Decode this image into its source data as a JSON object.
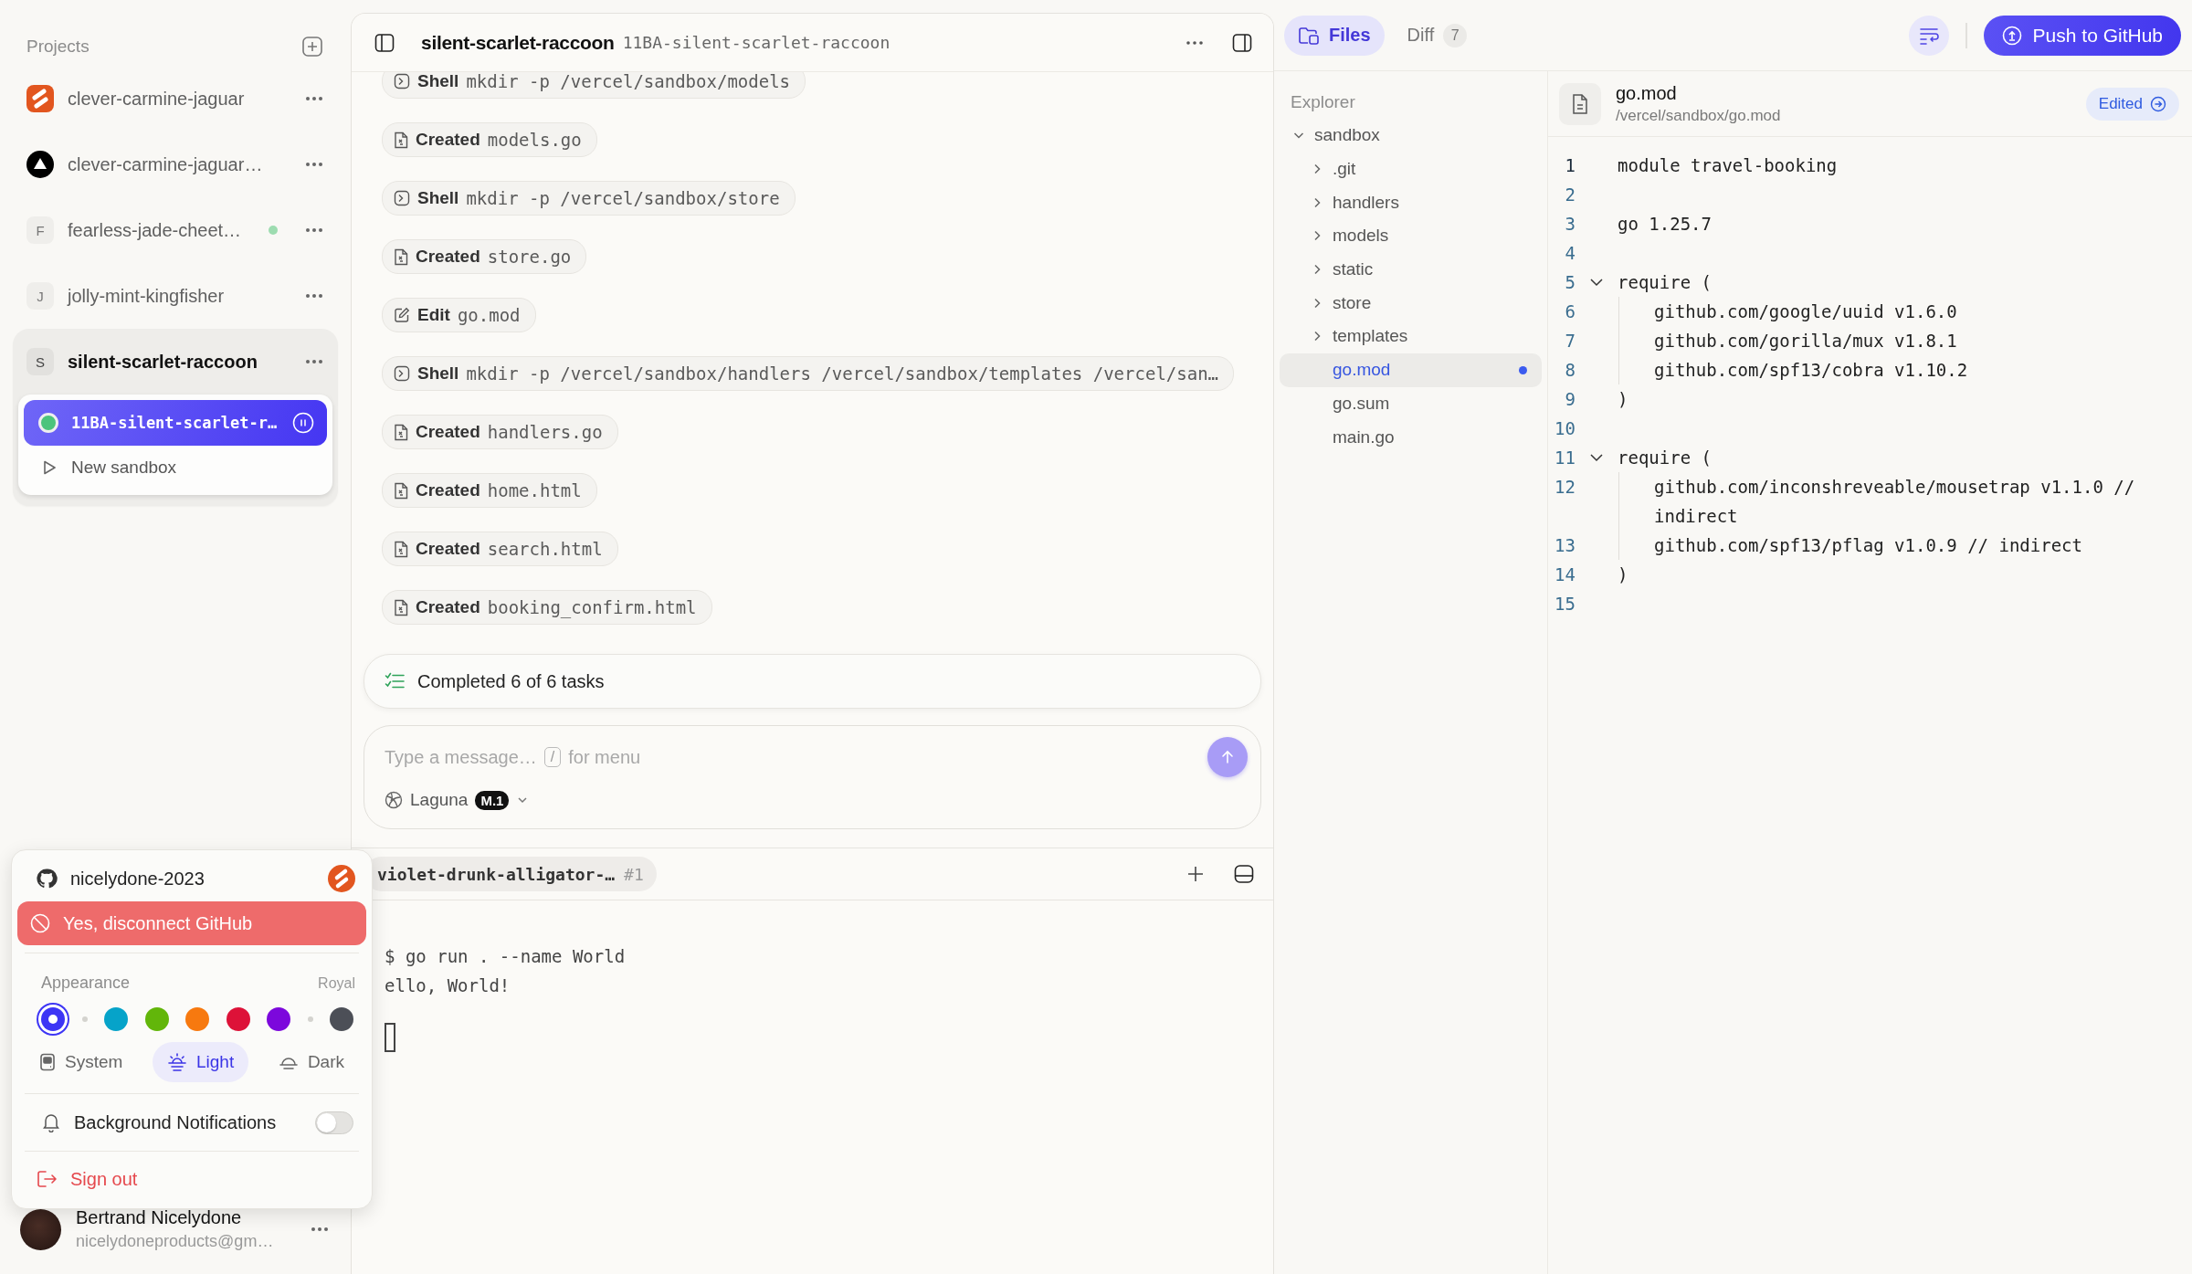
{
  "sidebar": {
    "title": "Projects",
    "projects": [
      {
        "name": "clever-carmine-jaguar",
        "kind": "orange-logo",
        "online": false,
        "selected": false
      },
      {
        "name": "clever-carmine-jaguar…",
        "kind": "triangle-logo",
        "online": false,
        "selected": false
      },
      {
        "name": "fearless-jade-cheet…",
        "kind": "letter",
        "letter": "F",
        "online": true,
        "selected": false
      },
      {
        "name": "jolly-mint-kingfisher",
        "kind": "letter",
        "letter": "J",
        "online": false,
        "selected": false
      },
      {
        "name": "silent-scarlet-raccoon",
        "kind": "letter",
        "letter": "S",
        "online": false,
        "selected": true,
        "sandboxes": [
          {
            "name": "11BA-silent-scarlet-r…",
            "running": true,
            "selected": true
          }
        ],
        "new_sandbox": "New sandbox"
      }
    ]
  },
  "account_menu": {
    "username": "nicelydone-2023",
    "disconnect": "Yes, disconnect GitHub",
    "appearance": "Appearance",
    "theme": "Royal",
    "swatches": [
      {
        "kind": "swatch",
        "color": "#3d35f5",
        "selected": true
      },
      {
        "kind": "separator"
      },
      {
        "kind": "swatch",
        "color": "#06a3c9",
        "selected": false
      },
      {
        "kind": "swatch",
        "color": "#62b60a",
        "selected": false
      },
      {
        "kind": "swatch",
        "color": "#f7790f",
        "selected": false
      },
      {
        "kind": "swatch",
        "color": "#dd1238",
        "selected": false
      },
      {
        "kind": "swatch",
        "color": "#7c08dc",
        "selected": false
      },
      {
        "kind": "separator"
      },
      {
        "kind": "swatch",
        "color": "#4c4f57",
        "selected": false
      }
    ],
    "modes": [
      {
        "label": "System",
        "kind": "system",
        "selected": false
      },
      {
        "label": "Light",
        "kind": "light",
        "selected": true
      },
      {
        "label": "Dark",
        "kind": "dark",
        "selected": false
      }
    ],
    "notifications": {
      "label": "Background Notifications",
      "on": false
    },
    "sign_out": "Sign out"
  },
  "user": {
    "name": "Bertrand Nicelydone",
    "email": "nicelydoneproducts@gm…"
  },
  "chat": {
    "title": "silent-scarlet-raccoon",
    "subtitle": "11BA-silent-scarlet-raccoon",
    "actions": [
      {
        "kind": "shell",
        "verb": "Shell",
        "arg": "mkdir -p /vercel/sandbox/models"
      },
      {
        "kind": "created",
        "verb": "Created",
        "arg": "models.go"
      },
      {
        "kind": "shell",
        "verb": "Shell",
        "arg": "mkdir -p /vercel/sandbox/store"
      },
      {
        "kind": "created",
        "verb": "Created",
        "arg": "store.go"
      },
      {
        "kind": "edit",
        "verb": "Edit",
        "arg": "go.mod"
      },
      {
        "kind": "shell",
        "verb": "Shell",
        "arg": "mkdir -p /vercel/sandbox/handlers /vercel/sandbox/templates /vercel/san…"
      },
      {
        "kind": "created",
        "verb": "Created",
        "arg": "handlers.go"
      },
      {
        "kind": "created",
        "verb": "Created",
        "arg": "home.html"
      },
      {
        "kind": "created",
        "verb": "Created",
        "arg": "search.html"
      },
      {
        "kind": "created",
        "verb": "Created",
        "arg": "booking_confirm.html"
      }
    ],
    "summary": "Completed 6 of 6 tasks",
    "composer": {
      "placeholder": "Type a message…",
      "shortcut_key": "/",
      "shortcut_hint": "for menu",
      "model": "Laguna",
      "model_badge": "M.1"
    }
  },
  "terminal": {
    "tab": "violet-drunk-alligator-…",
    "tab_number": "#1",
    "lines": [
      "$ go run . --name World",
      "ello, World!"
    ]
  },
  "top_tabs": [
    {
      "label": "Files",
      "kind": "files",
      "selected": true
    },
    {
      "label": "Diff",
      "kind": "diff",
      "count": "7",
      "selected": false
    }
  ],
  "push_button": "Push to GitHub",
  "explorer": {
    "title": "Explorer",
    "tree": [
      {
        "name": "sandbox",
        "kind": "folder",
        "expanded": true,
        "selected": false,
        "children": [
          {
            "name": ".git",
            "kind": "folder",
            "expanded": false,
            "selected": false
          },
          {
            "name": "handlers",
            "kind": "folder",
            "expanded": false,
            "selected": false
          },
          {
            "name": "models",
            "kind": "folder",
            "expanded": false,
            "selected": false
          },
          {
            "name": "static",
            "kind": "folder",
            "expanded": false,
            "selected": false
          },
          {
            "name": "store",
            "kind": "folder",
            "expanded": false,
            "selected": false
          },
          {
            "name": "templates",
            "kind": "folder",
            "expanded": false,
            "selected": false
          },
          {
            "name": "go.mod",
            "kind": "file",
            "modified": true,
            "selected": true
          },
          {
            "name": "go.sum",
            "kind": "file",
            "modified": false,
            "selected": false
          },
          {
            "name": "main.go",
            "kind": "file",
            "modified": false,
            "selected": false
          }
        ]
      }
    ]
  },
  "editor": {
    "file_name": "go.mod",
    "file_path": "/vercel/sandbox/go.mod",
    "status": "Edited",
    "lines": [
      {
        "number": "1",
        "kind": "plain",
        "text": "module travel-booking",
        "current": true
      },
      {
        "number": "2",
        "kind": "plain",
        "current": false
      },
      {
        "number": "3",
        "kind": "plain",
        "text": "go 1.25.7",
        "current": false
      },
      {
        "number": "4",
        "kind": "plain",
        "current": false
      },
      {
        "number": "5",
        "kind": "fold",
        "text": "require (",
        "current": false
      },
      {
        "number": "6",
        "kind": "indented",
        "text": "github.com/google/uuid v1.6.0",
        "current": false
      },
      {
        "number": "7",
        "kind": "indented",
        "text": "github.com/gorilla/mux v1.8.1",
        "current": false
      },
      {
        "number": "8",
        "kind": "indented",
        "text": "github.com/spf13/cobra v1.10.2",
        "current": false
      },
      {
        "number": "9",
        "kind": "plain",
        "text": ")",
        "current": false
      },
      {
        "number": "10",
        "kind": "plain",
        "current": false
      },
      {
        "number": "11",
        "kind": "fold",
        "text": "require (",
        "current": false
      },
      {
        "number": "12",
        "kind": "indented",
        "text": "github.com/inconshreveable/mousetrap v1.1.0 // indirect",
        "current": false
      },
      {
        "number": "13",
        "kind": "indented",
        "text": "github.com/spf13/pflag v1.0.9 // indirect",
        "current": false
      },
      {
        "number": "14",
        "kind": "plain",
        "text": ")",
        "current": false
      },
      {
        "number": "15",
        "kind": "plain",
        "current": false
      }
    ]
  }
}
